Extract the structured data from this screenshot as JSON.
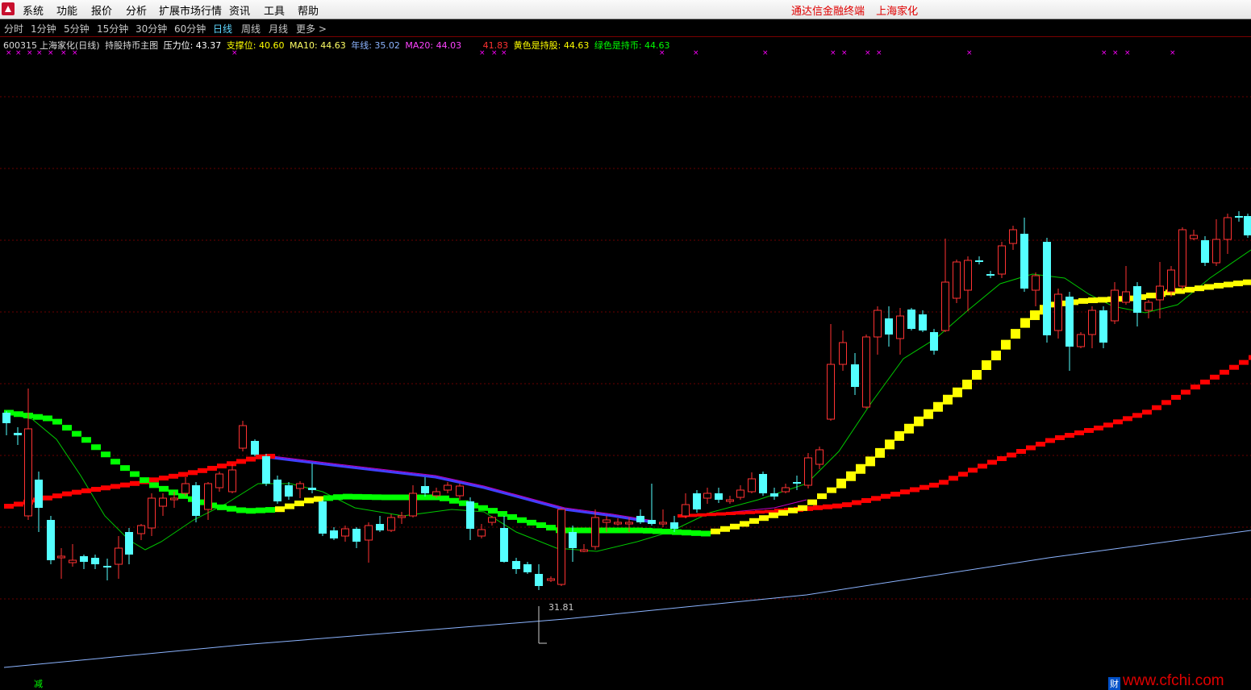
{
  "menubar": {
    "items": [
      "系统",
      "功能",
      "报价",
      "分析",
      "扩展市场行情",
      "资讯",
      "工具",
      "帮助"
    ],
    "right_product": "通达信金融终端",
    "right_stock": "上海家化"
  },
  "periods": {
    "items": [
      "分时",
      "1分钟",
      "5分钟",
      "15分钟",
      "30分钟",
      "60分钟",
      "日线",
      "周线",
      "月线",
      "更多 >"
    ],
    "active": "日线"
  },
  "legend": {
    "code": "600315",
    "name_period": "上海家化(日线)",
    "indicator": "持股持币主图",
    "pressure": "压力位: 43.37",
    "support": "支撑位: 40.60",
    "ma10": "MA10: 44.63",
    "year_line": "年线: 35.02",
    "ma20": "MA20: 44.03",
    "red_value": "41.83",
    "yellow": "黄色是持股: 44.63",
    "green": "绿色是持币: 44.63"
  },
  "annotations": {
    "low_label": "31.81"
  },
  "colors": {
    "background": "#000000",
    "up_candle": "#ff3232",
    "down_candle": "#54ffff",
    "hold_line": "#ffff00",
    "cash_line": "#00ff00",
    "red_line": "#ff0000",
    "ma10": "#00c800",
    "ma20": "#c000c0",
    "year_line": "#8cb4ff",
    "x_marker": "#ff00ff"
  },
  "bottom": {
    "left_badge": "减",
    "right_badge": "财",
    "watermark": "www.cfchi.com"
  }
}
